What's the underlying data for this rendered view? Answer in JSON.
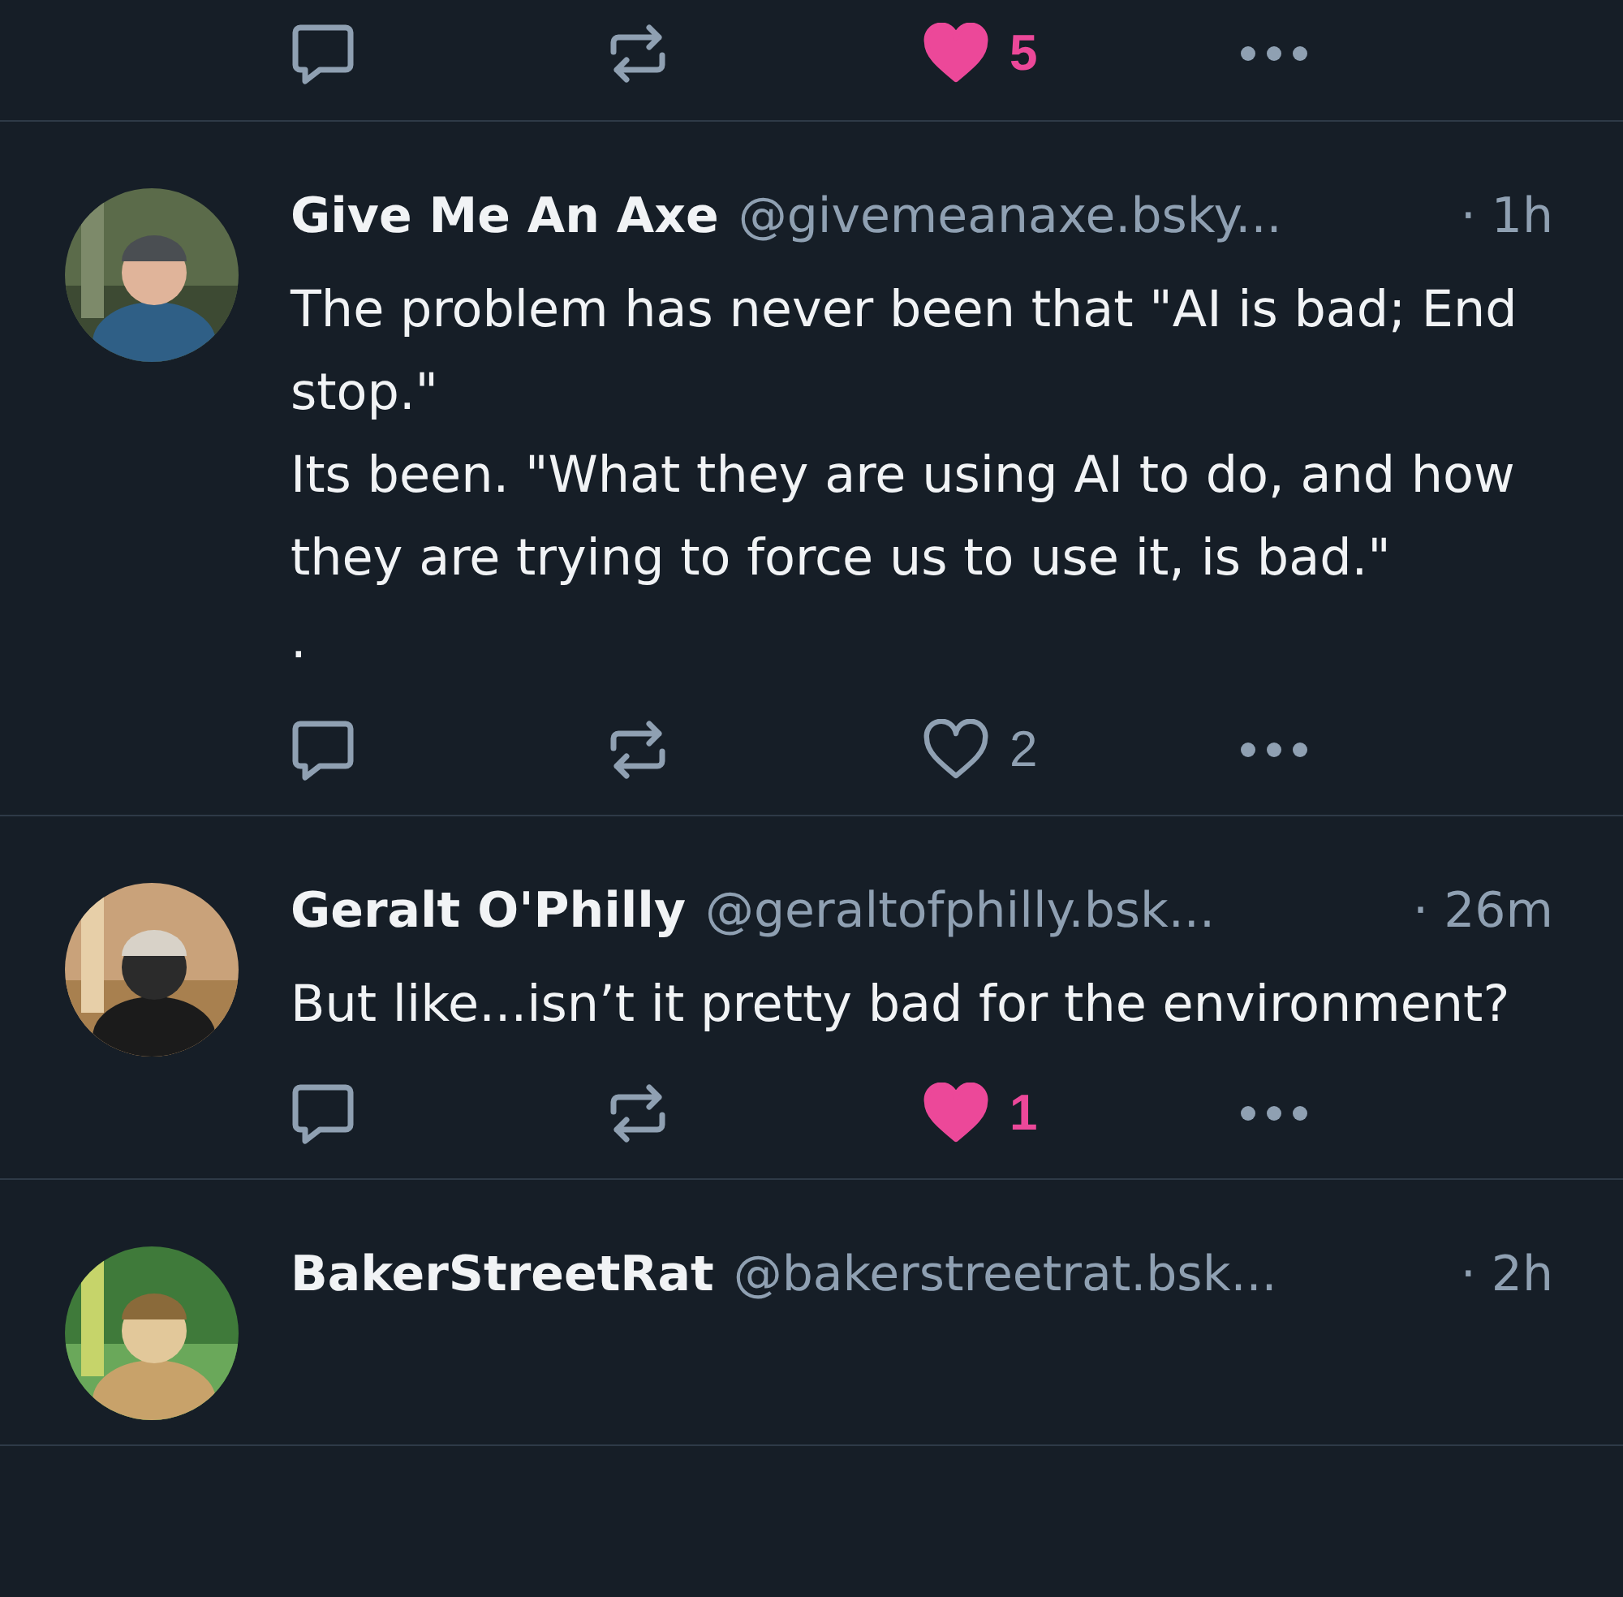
{
  "top_actions": {
    "like": {
      "count": "5",
      "liked": true
    }
  },
  "posts": [
    {
      "name": "Give Me An Axe",
      "handle": "@givemeanaxe.bsky...",
      "time": "· 1h",
      "text": "The problem has never been that \"AI is bad; End stop.\"\nIts been. \"What they are using AI to do, and how they are trying to force us to use it, is bad.\"\n.",
      "like": {
        "count": "2",
        "liked": false
      }
    },
    {
      "name": "Geralt O'Philly",
      "handle": "@geraltofphilly.bsk...",
      "time": "· 26m",
      "text": "But like...isn’t it pretty bad for the environment?",
      "like": {
        "count": "1",
        "liked": true
      }
    },
    {
      "name": "BakerStreetRat",
      "handle": "@bakerstreetrat.bsk...",
      "time": "· 2h"
    }
  ]
}
